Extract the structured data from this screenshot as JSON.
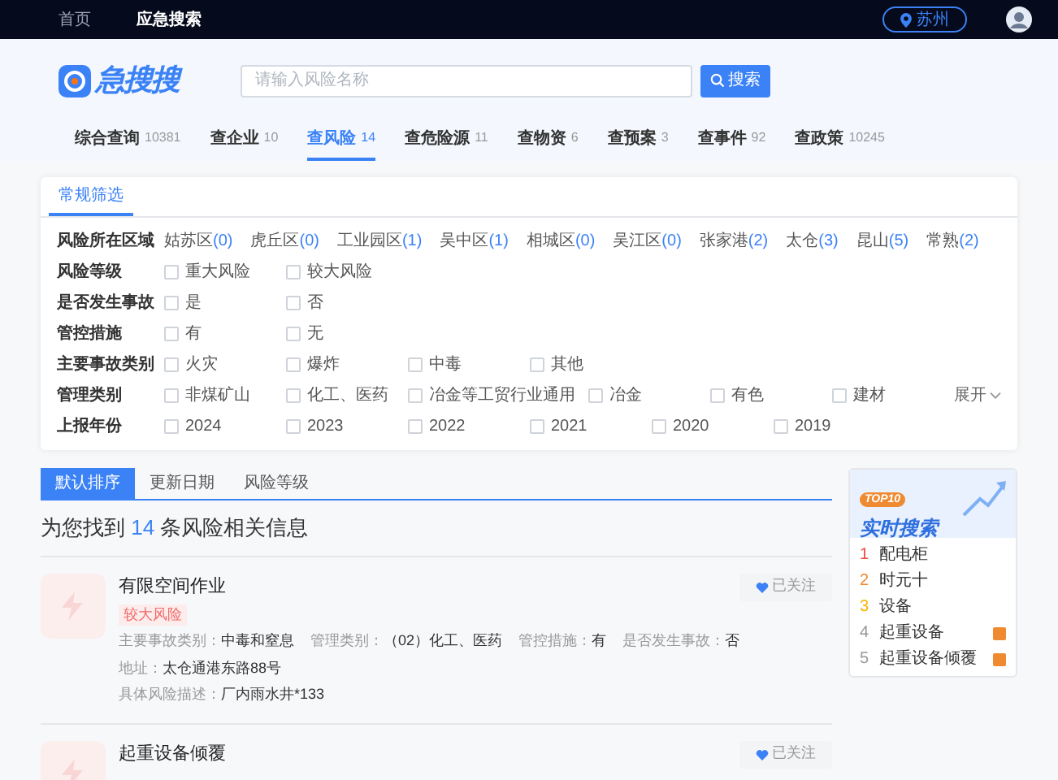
{
  "top_nav": {
    "links": [
      {
        "label": "首页",
        "selected": false
      },
      {
        "label": "应急搜索",
        "selected": true
      }
    ],
    "location": "苏州"
  },
  "header": {
    "logo_text": "急搜搜",
    "search": {
      "placeholder": "请输入风险名称"
    },
    "search_button": "搜索"
  },
  "category_tabs": [
    {
      "label": "综合查询",
      "count": "10381",
      "selected": false
    },
    {
      "label": "查企业",
      "count": "10",
      "selected": false
    },
    {
      "label": "查风险",
      "count": "14",
      "selected": true
    },
    {
      "label": "查危险源",
      "count": "11",
      "selected": false
    },
    {
      "label": "查物资",
      "count": "6",
      "selected": false
    },
    {
      "label": "查预案",
      "count": "3",
      "selected": false
    },
    {
      "label": "查事件",
      "count": "92",
      "selected": false
    },
    {
      "label": "查政策",
      "count": "10245",
      "selected": false
    }
  ],
  "filter": {
    "tabs": [
      {
        "label": "常规筛选",
        "selected": true
      }
    ],
    "region": {
      "label": "风险所在区域",
      "items": [
        {
          "name": "姑苏区",
          "count": "(0)"
        },
        {
          "name": "虎丘区",
          "count": "(0)"
        },
        {
          "name": "工业园区",
          "count": "(1)"
        },
        {
          "name": "吴中区",
          "count": "(1)"
        },
        {
          "name": "相城区",
          "count": "(0)"
        },
        {
          "name": "吴江区",
          "count": "(0)"
        },
        {
          "name": "张家港",
          "count": "(2)"
        },
        {
          "name": "太仓",
          "count": "(3)"
        },
        {
          "name": "昆山",
          "count": "(5)"
        },
        {
          "name": "常熟",
          "count": "(2)"
        }
      ]
    },
    "groups": [
      {
        "label": "风险等级",
        "options": [
          {
            "label": "重大风险",
            "checked": false
          },
          {
            "label": "较大风险",
            "checked": false
          }
        ]
      },
      {
        "label": "是否发生事故",
        "options": [
          {
            "label": "是",
            "checked": false
          },
          {
            "label": "否",
            "checked": false
          }
        ]
      },
      {
        "label": "管控措施",
        "options": [
          {
            "label": "有",
            "checked": false
          },
          {
            "label": "无",
            "checked": false
          }
        ]
      },
      {
        "label": "主要事故类别",
        "options": [
          {
            "label": "火灾",
            "checked": false
          },
          {
            "label": "爆炸",
            "checked": false
          },
          {
            "label": "中毒",
            "checked": false
          },
          {
            "label": "其他",
            "checked": false
          }
        ]
      },
      {
        "label": "管理类别",
        "options": [
          {
            "label": "非煤矿山",
            "checked": false
          },
          {
            "label": "化工、医药",
            "checked": false
          },
          {
            "label": "冶金等工贸行业通用",
            "checked": false
          },
          {
            "label": "冶金",
            "checked": false
          },
          {
            "label": "有色",
            "checked": false
          },
          {
            "label": "建材",
            "checked": false
          }
        ],
        "expand": "展开"
      },
      {
        "label": "上报年份",
        "options": [
          {
            "label": "2024",
            "checked": false
          },
          {
            "label": "2023",
            "checked": false
          },
          {
            "label": "2022",
            "checked": false
          },
          {
            "label": "2021",
            "checked": false
          },
          {
            "label": "2020",
            "checked": false
          },
          {
            "label": "2019",
            "checked": false
          }
        ]
      }
    ]
  },
  "sort_tabs": [
    {
      "label": "默认排序",
      "selected": true
    },
    {
      "label": "更新日期",
      "selected": false
    },
    {
      "label": "风险等级",
      "selected": false
    }
  ],
  "results_summary": {
    "prefix": "为您找到",
    "count": "14",
    "suffix": "条风险相关信息"
  },
  "results": [
    {
      "title": "有限空间作业",
      "tag": "较大风险",
      "follow_label": "已关注",
      "followed": true,
      "lines": [
        [
          {
            "label": "主要事故类别：",
            "value": "中毒和窒息"
          },
          {
            "label": "管理类别：",
            "value": "（02）化工、医药"
          },
          {
            "label": "管控措施：",
            "value": "有"
          },
          {
            "label": "是否发生事故：",
            "value": "否"
          }
        ],
        [
          {
            "label": "地址：",
            "value": "太仓通港东路88号"
          }
        ],
        [
          {
            "label": "具体风险描述：",
            "value": "厂内雨水井*133"
          }
        ]
      ]
    },
    {
      "title": "起重设备倾覆",
      "follow_label": "已关注",
      "followed": true
    }
  ],
  "hot_search": {
    "badge": "TOP10",
    "title": "实时搜索",
    "items": [
      {
        "rank": "1",
        "label": "配电柜",
        "color": "#f04a3e",
        "hot": false
      },
      {
        "rank": "2",
        "label": "时元十",
        "color": "#f08a30",
        "hot": false
      },
      {
        "rank": "3",
        "label": "设备",
        "color": "#f5b400",
        "hot": false
      },
      {
        "rank": "4",
        "label": "起重设备",
        "color": "#999999",
        "hot": true
      },
      {
        "rank": "5",
        "label": "起重设备倾覆",
        "color": "#999999",
        "hot": true
      }
    ]
  }
}
